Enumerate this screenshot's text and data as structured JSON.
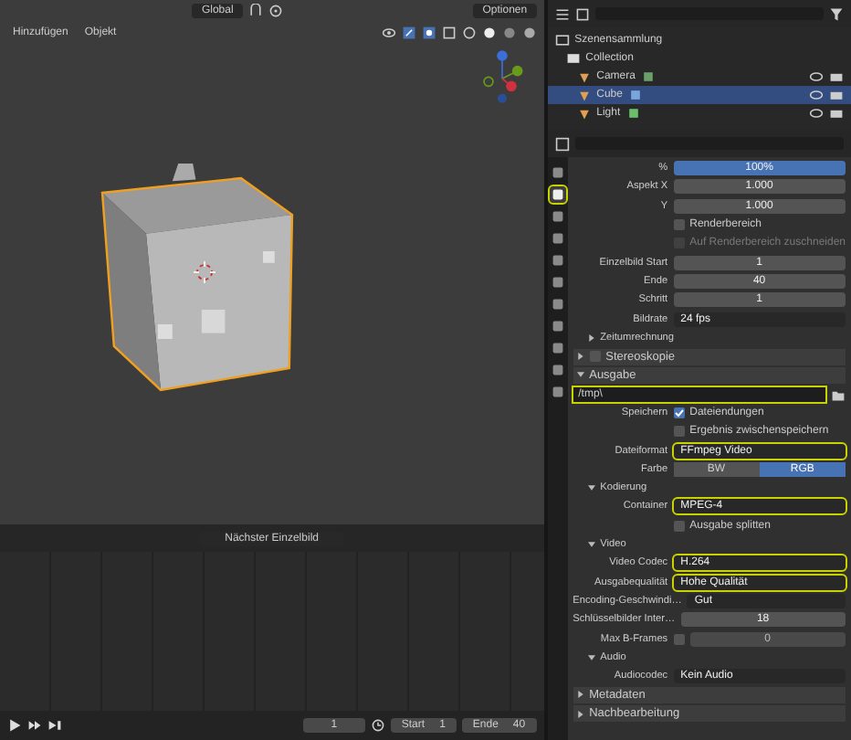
{
  "viewport": {
    "orientation": "Global",
    "options": "Optionen",
    "menus": [
      "Hinzufügen",
      "Objekt"
    ]
  },
  "outliner": {
    "root": "Szenensammlung",
    "collection": "Collection",
    "items": [
      {
        "label": "Camera",
        "selected": false,
        "color": "#6aa06a"
      },
      {
        "label": "Cube",
        "selected": true,
        "color": "#7aa6e0"
      },
      {
        "label": "Light",
        "selected": false,
        "color": "#6ac06a"
      }
    ]
  },
  "properties": {
    "tabs": [
      {
        "selected": false
      },
      {
        "selected": true
      },
      {
        "selected": false
      },
      {
        "selected": false
      },
      {
        "selected": false
      },
      {
        "selected": false
      },
      {
        "selected": false
      },
      {
        "selected": false
      },
      {
        "selected": false
      },
      {
        "selected": false
      },
      {
        "selected": false
      }
    ],
    "rows": [
      {
        "kind": "slider",
        "label": "%",
        "value": "100%",
        "level": 1
      },
      {
        "kind": "field",
        "label": "Aspekt X",
        "value": "1.000",
        "highlighted": false
      },
      {
        "kind": "field",
        "label": "Y",
        "value": "1.000",
        "highlighted": false
      },
      {
        "kind": "check",
        "label": "Renderbereich",
        "checked": false,
        "disabled": false
      },
      {
        "kind": "check",
        "label": "Auf Renderbereich zuschneiden",
        "checked": false,
        "disabled": true
      },
      {
        "kind": "field",
        "label": "Einzelbild Start",
        "value": "1",
        "highlighted": false
      },
      {
        "kind": "field",
        "label": "Ende",
        "value": "40",
        "highlighted": false
      },
      {
        "kind": "field",
        "label": "Schritt",
        "value": "1",
        "highlighted": false
      },
      {
        "kind": "dropdown",
        "label": "Bildrate",
        "value": "24 fps",
        "highlighted": false
      },
      {
        "kind": "subsection",
        "label": "Zeitumrechnung",
        "expanded": false
      },
      {
        "kind": "section-check",
        "label": "Stereoskopie",
        "expanded": false,
        "checked": false
      },
      {
        "kind": "section",
        "label": "Ausgabe",
        "expanded": true
      },
      {
        "kind": "path",
        "value": "/tmp\\",
        "highlighted": true
      },
      {
        "kind": "check",
        "label": "Dateiendungen",
        "caption": "Speichern",
        "checked": true,
        "disabled": false
      },
      {
        "kind": "check",
        "label": "Ergebnis zwischenspeichern",
        "checked": false,
        "disabled": false
      },
      {
        "kind": "dropdown",
        "label": "Dateiformat",
        "value": "FFmpeg Video",
        "highlighted": true
      },
      {
        "kind": "toggle",
        "label": "Farbe",
        "options": [
          {
            "label": "BW",
            "selected": false
          },
          {
            "label": "RGB",
            "selected": true
          }
        ]
      },
      {
        "kind": "subsection",
        "label": "Kodierung",
        "expanded": true
      },
      {
        "kind": "dropdown",
        "label": "Container",
        "value": "MPEG-4",
        "highlighted": true
      },
      {
        "kind": "check",
        "label": "Ausgabe splitten",
        "checked": false,
        "disabled": false
      },
      {
        "kind": "subsection",
        "label": "Video",
        "expanded": true
      },
      {
        "kind": "dropdown",
        "label": "Video Codec",
        "value": "H.264",
        "highlighted": true
      },
      {
        "kind": "dropdown",
        "label": "Ausgabequalität",
        "value": "Hohe Qualität",
        "highlighted": true
      },
      {
        "kind": "dropdown",
        "label": "Encoding-Geschwindi…",
        "value": "Gut",
        "highlighted": false
      },
      {
        "kind": "field",
        "label": "Schlüsselbilder Inter…",
        "value": "18",
        "highlighted": false
      },
      {
        "kind": "checkfield",
        "label": "Max B-Frames",
        "checked": false,
        "value": "0"
      },
      {
        "kind": "subsection",
        "label": "Audio",
        "expanded": true
      },
      {
        "kind": "dropdown",
        "label": "Audiocodec",
        "value": "Kein Audio",
        "highlighted": false
      },
      {
        "kind": "section",
        "label": "Metadaten",
        "expanded": false
      },
      {
        "kind": "section",
        "label": "Nachbearbeitung",
        "expanded": false
      }
    ]
  },
  "timeline": {
    "keying": "Nächster Einzelbild",
    "current": "1",
    "start_label": "Start",
    "start": "1",
    "end_label": "Ende",
    "end": "40"
  }
}
